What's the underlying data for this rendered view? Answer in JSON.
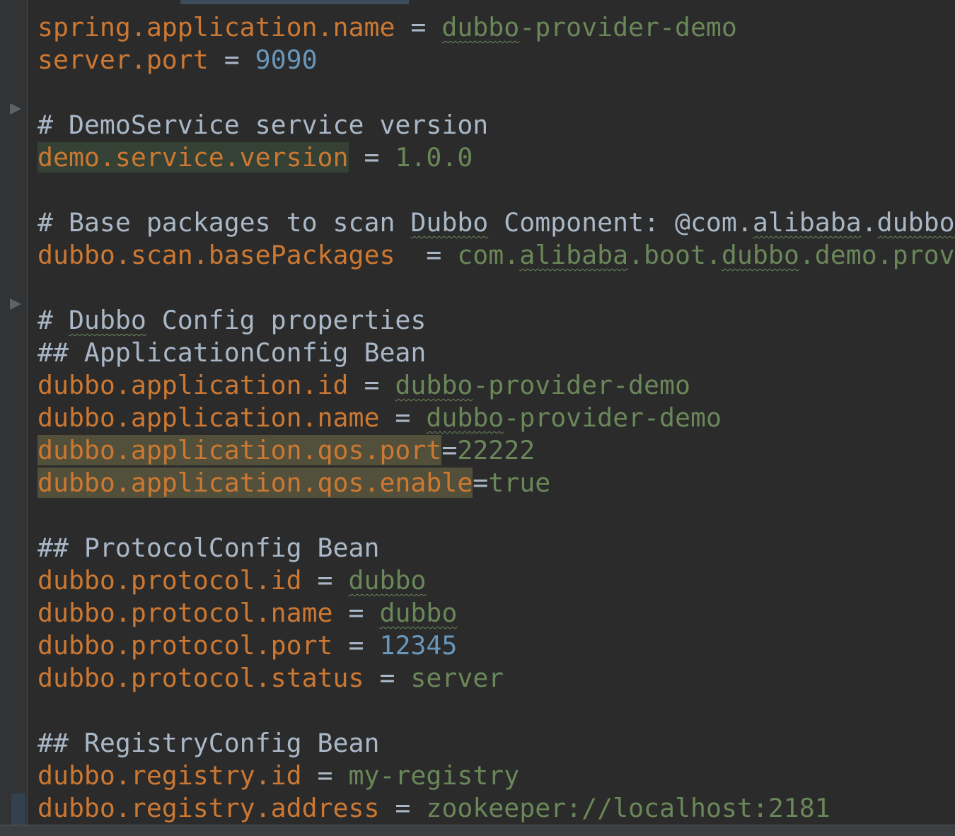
{
  "editor": {
    "lines": [
      {
        "type": "prop",
        "key": "spring.application.name",
        "sep": " = ",
        "value": "",
        "valueParts": [
          {
            "t": "dubbo",
            "typo": true
          },
          {
            "t": "-provider-demo"
          }
        ],
        "valueKind": "str"
      },
      {
        "type": "prop",
        "key": "server.port",
        "sep": " = ",
        "valueKind": "num",
        "value": "9090"
      },
      {
        "type": "blank"
      },
      {
        "type": "comment",
        "parts": [
          {
            "t": "# DemoService service version"
          }
        ]
      },
      {
        "type": "prop",
        "key": "demo.service.version",
        "sep": " = ",
        "valueKind": "str",
        "value": "1.0.0",
        "current": true,
        "keyHighlight": "hl-key"
      },
      {
        "type": "blank"
      },
      {
        "type": "comment",
        "parts": [
          {
            "t": "# Base packages to scan "
          },
          {
            "t": "Dubbo",
            "typo": true
          },
          {
            "t": " Component: @com."
          },
          {
            "t": "alibaba",
            "typo": true
          },
          {
            "t": "."
          },
          {
            "t": "dubbo",
            "typo": true
          }
        ]
      },
      {
        "type": "prop",
        "key": "dubbo.scan.basePackages",
        "sep": "  = ",
        "valueKind": "str",
        "valueParts": [
          {
            "t": "com."
          },
          {
            "t": "alibaba",
            "typo": true
          },
          {
            "t": ".boot."
          },
          {
            "t": "dubbo",
            "typo": true
          },
          {
            "t": ".demo.prov"
          }
        ]
      },
      {
        "type": "blank"
      },
      {
        "type": "comment",
        "parts": [
          {
            "t": "# "
          },
          {
            "t": "Dubbo",
            "typo": true
          },
          {
            "t": " Config properties"
          }
        ]
      },
      {
        "type": "comment",
        "parts": [
          {
            "t": "## ApplicationConfig Bean"
          }
        ]
      },
      {
        "type": "prop",
        "key": "dubbo.application.id",
        "sep": " = ",
        "valueKind": "str",
        "valueParts": [
          {
            "t": "dubbo",
            "typo": true
          },
          {
            "t": "-provider-demo"
          }
        ]
      },
      {
        "type": "prop",
        "key": "dubbo.application.name",
        "sep": " = ",
        "valueKind": "str",
        "valueParts": [
          {
            "t": "dubbo",
            "typo": true
          },
          {
            "t": "-provider-demo"
          }
        ]
      },
      {
        "type": "prop",
        "key": "dubbo.application.qos.port",
        "sep": "=",
        "valueKind": "str",
        "value": "22222",
        "keyHighlight": "hl-warn"
      },
      {
        "type": "prop",
        "key": "dubbo.application.qos.enable",
        "sep": "=",
        "valueKind": "str",
        "value": "true",
        "keyHighlight": "hl-warn"
      },
      {
        "type": "blank"
      },
      {
        "type": "comment",
        "parts": [
          {
            "t": "## ProtocolConfig Bean"
          }
        ]
      },
      {
        "type": "prop",
        "key": "dubbo.protocol.id",
        "sep": " = ",
        "valueKind": "str",
        "valueParts": [
          {
            "t": "dubbo",
            "typo": true
          }
        ]
      },
      {
        "type": "prop",
        "key": "dubbo.protocol.name",
        "sep": " = ",
        "valueKind": "str",
        "valueParts": [
          {
            "t": "dubbo",
            "typo": true
          }
        ]
      },
      {
        "type": "prop",
        "key": "dubbo.protocol.port",
        "sep": " = ",
        "valueKind": "num",
        "value": "12345"
      },
      {
        "type": "prop",
        "key": "dubbo.protocol.status",
        "sep": " = ",
        "valueKind": "str",
        "value": "server"
      },
      {
        "type": "blank"
      },
      {
        "type": "comment",
        "parts": [
          {
            "t": "## RegistryConfig Bean"
          }
        ]
      },
      {
        "type": "prop",
        "key": "dubbo.registry.id",
        "sep": " = ",
        "valueKind": "str",
        "value": "my-registry"
      },
      {
        "type": "prop",
        "key": "dubbo.registry.address",
        "sep": " = ",
        "valueKind": "str",
        "value": "zookeeper://localhost:2181"
      }
    ]
  },
  "colors": {
    "background": "#2b2b2b",
    "gutter": "#313335",
    "key": "#cc7832",
    "string": "#6a8759",
    "number": "#6897bb",
    "comment": "#a9b7c6"
  }
}
